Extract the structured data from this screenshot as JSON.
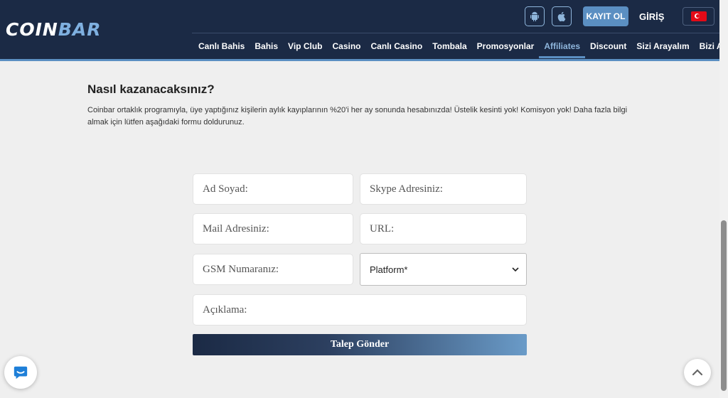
{
  "header": {
    "logo_left": "COIN",
    "logo_right": "BAR",
    "android_icon": "android-icon",
    "apple_icon": "apple-icon",
    "register_label": "KAYIT OL",
    "login_label": "GİRİŞ",
    "language_flag": "turkey-flag-icon"
  },
  "nav": {
    "items": [
      "Canlı Bahis",
      "Bahis",
      "Vip Club",
      "Casino",
      "Canlı Casino",
      "Tombala",
      "Promosyonlar",
      "Affiliates",
      "Discount",
      "Sizi Arayalım",
      "Bizi Arayın"
    ],
    "active": "Affiliates"
  },
  "content": {
    "heading": "Nasıl kazanacaksınız?",
    "description": "Coinbar ortaklık programıyla, üye yaptığınız kişilerin aylık kayıplarının %20'i her ay sonunda hesabınızda! Üstelik kesinti yok! Komisyon yok! Daha fazla bilgi almak için lütfen aşağıdaki formu doldurunuz."
  },
  "form": {
    "name_placeholder": "Ad Soyad:",
    "skype_placeholder": "Skype Adresiniz:",
    "mail_placeholder": "Mail Adresiniz:",
    "url_placeholder": "URL:",
    "gsm_placeholder": "GSM Numaranız:",
    "platform_selected": "Platform*",
    "description_placeholder": "Açıklama:",
    "submit_label": "Talep Gönder"
  },
  "colors": {
    "header_bg": "#1b2a45",
    "accent": "#5b8fc2",
    "page_bg": "#efefef"
  },
  "floating": {
    "chat_icon": "chat-icon",
    "scroll_top_icon": "chevron-up-icon"
  }
}
